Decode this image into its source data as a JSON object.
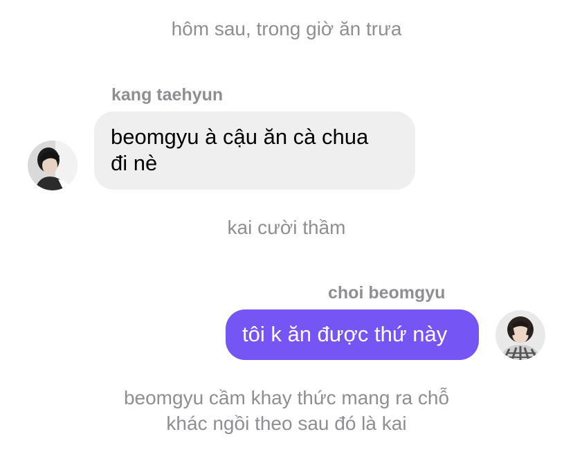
{
  "narrations": [
    "hôm sau, trong giờ ăn trưa",
    "kai cười thầm",
    "beomgyu cầm khay thức mang ra chỗ",
    "khác ngồi theo sau đó là kai"
  ],
  "messages": [
    {
      "sender": "kang taehyun",
      "direction": "incoming",
      "lines": [
        "beomgyu à cậu ăn cà chua",
        "đi nè"
      ],
      "avatar_icon": "profile-photo-taehyun"
    },
    {
      "sender": "choi beomgyu",
      "direction": "outgoing",
      "lines": [
        "tôi k ăn được thứ này"
      ],
      "avatar_icon": "profile-photo-beomgyu"
    }
  ],
  "colors": {
    "incoming_bubble": "#efefef",
    "outgoing_bubble": "#7655f5",
    "narration_text": "#8e8e93"
  }
}
